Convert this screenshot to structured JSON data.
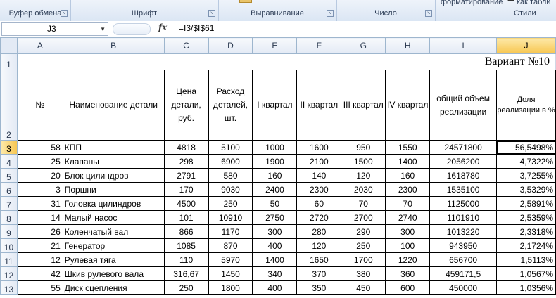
{
  "ribbon": {
    "groups": [
      "Буфер обмена",
      "Шрифт",
      "Выравнивание",
      "Число",
      "Стили"
    ],
    "top_items": [
      "форматирование",
      "как табли"
    ]
  },
  "formula_bar": {
    "name_box": "J3",
    "formula": "=I3/$I$61"
  },
  "columns": [
    "A",
    "B",
    "C",
    "D",
    "E",
    "F",
    "G",
    "H",
    "I",
    "J"
  ],
  "row_numbers": [
    "1",
    "2",
    "3",
    "4",
    "5",
    "6",
    "7",
    "8",
    "9",
    "10",
    "11",
    "12",
    "13"
  ],
  "title": "Вариант №10",
  "headers": [
    "№",
    "Наименование детали",
    "Цена детали, руб.",
    "Расход деталей, шт.",
    "I квартал",
    "II квартал",
    "III квартал",
    "IV квартал",
    "общий объем реализации",
    "Доля реализации в %"
  ],
  "rows": [
    [
      "58",
      "КПП",
      "4818",
      "5100",
      "1000",
      "1600",
      "950",
      "1550",
      "24571800",
      "56,5498%"
    ],
    [
      "25",
      "Клапаны",
      "298",
      "6900",
      "1900",
      "2100",
      "1500",
      "1400",
      "2056200",
      "4,7322%"
    ],
    [
      "20",
      "Блок цилиндров",
      "2791",
      "580",
      "160",
      "140",
      "120",
      "160",
      "1618780",
      "3,7255%"
    ],
    [
      "3",
      "Поршни",
      "170",
      "9030",
      "2400",
      "2300",
      "2030",
      "2300",
      "1535100",
      "3,5329%"
    ],
    [
      "31",
      "Головка цилиндров",
      "4500",
      "250",
      "50",
      "60",
      "70",
      "70",
      "1125000",
      "2,5891%"
    ],
    [
      "14",
      "Малый насос",
      "101",
      "10910",
      "2750",
      "2720",
      "2700",
      "2740",
      "1101910",
      "2,5359%"
    ],
    [
      "26",
      "Коленчатый вал",
      "866",
      "1170",
      "300",
      "280",
      "290",
      "300",
      "1013220",
      "2,3318%"
    ],
    [
      "21",
      "Генератор",
      "1085",
      "870",
      "400",
      "120",
      "250",
      "100",
      "943950",
      "2,1724%"
    ],
    [
      "12",
      "Рулевая тяга",
      "110",
      "5970",
      "1400",
      "1650",
      "1700",
      "1220",
      "656700",
      "1,5113%"
    ],
    [
      "42",
      "Шкив рулевого вала",
      "316,67",
      "1450",
      "340",
      "370",
      "380",
      "360",
      "459171,5",
      "1,0567%"
    ],
    [
      "55",
      "Диск сцепления",
      "250",
      "1800",
      "400",
      "350",
      "450",
      "600",
      "450000",
      "1,0356%"
    ]
  ]
}
